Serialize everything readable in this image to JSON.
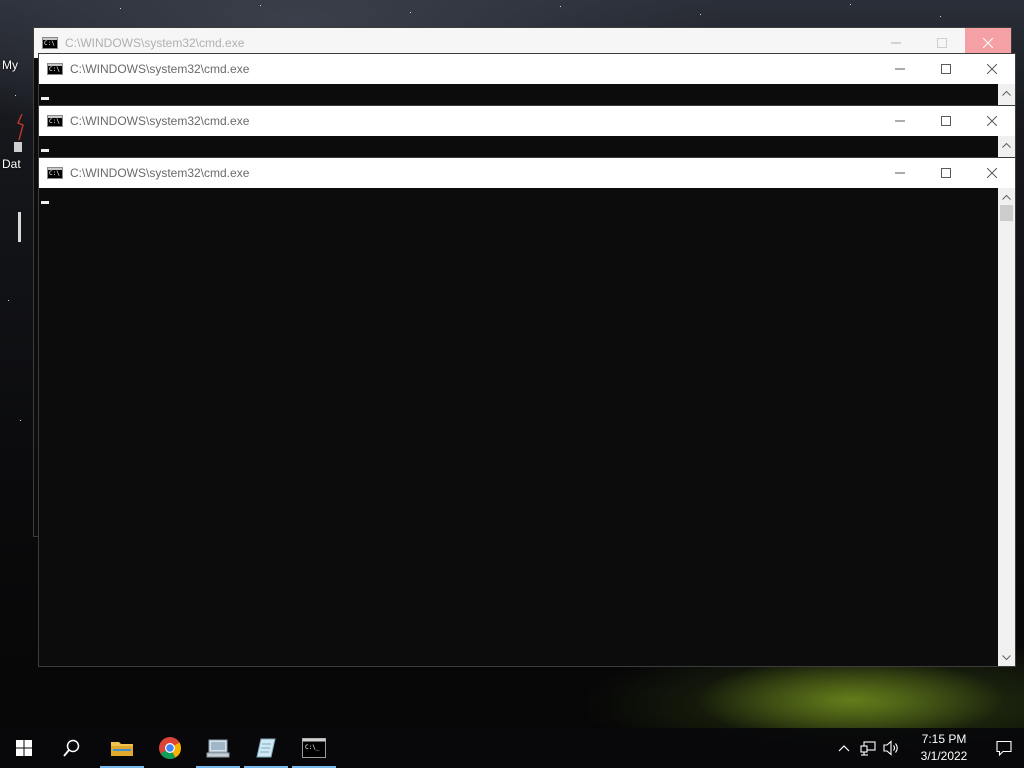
{
  "desktop": {
    "icon_labels": [
      "My",
      "Dat"
    ]
  },
  "windows": [
    {
      "title": "C:\\WINDOWS\\system32\\cmd.exe",
      "state": "inactive"
    },
    {
      "title": "C:\\WINDOWS\\system32\\cmd.exe",
      "state": "inactive"
    },
    {
      "title": "C:\\WINDOWS\\system32\\cmd.exe",
      "state": "inactive"
    },
    {
      "title": "C:\\WINDOWS\\system32\\cmd.exe",
      "state": "active"
    }
  ],
  "taskbar": {
    "pinned": [
      {
        "name": "start",
        "icon": "windows-logo-icon"
      },
      {
        "name": "search",
        "icon": "search-icon"
      },
      {
        "name": "file-explorer",
        "icon": "folder-icon",
        "running": true
      },
      {
        "name": "chrome",
        "icon": "chrome-icon",
        "running": false
      },
      {
        "name": "app-3",
        "icon": "computer-app-icon",
        "running": true
      },
      {
        "name": "app-4",
        "icon": "notepad-app-icon",
        "running": true
      },
      {
        "name": "cmd",
        "icon": "terminal-icon",
        "running": true
      }
    ],
    "clock": {
      "time": "7:15 PM",
      "date": "3/1/2022"
    }
  },
  "colors": {
    "console_bg": "#0c0c0c",
    "titlebar_bg": "#ffffff",
    "running_indicator": "#76b9ed",
    "close_hover": "#f4a0a5"
  }
}
